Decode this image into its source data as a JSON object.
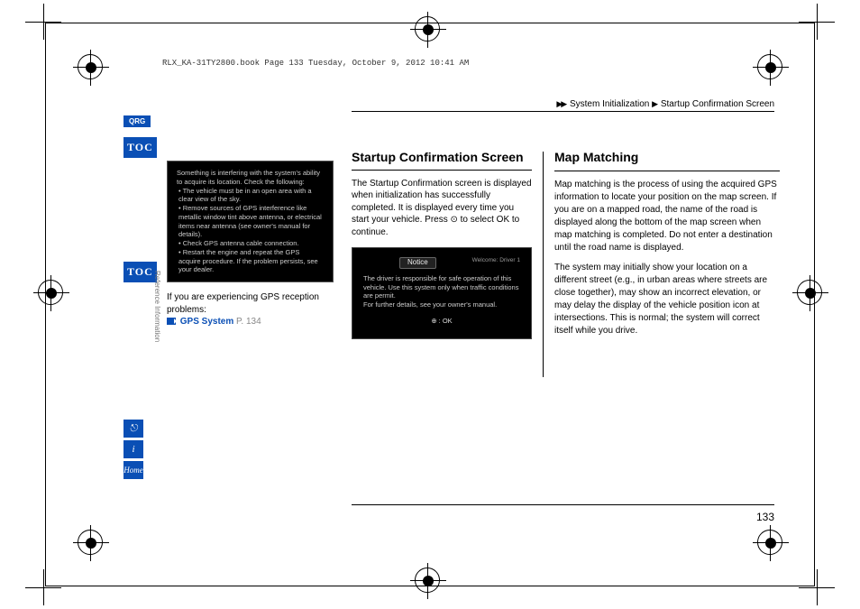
{
  "header_line": "RLX_KA-31TY2800.book  Page 133  Tuesday, October 9, 2012  10:41 AM",
  "breadcrumb": {
    "arrows": "▶▶",
    "part1": "System Initialization",
    "sep": "▶",
    "part2": "Startup Confirmation Screen"
  },
  "badges": {
    "qrg": "QRG",
    "toc": "TOC"
  },
  "side_icons": {
    "voice": "⎋",
    "info": "i",
    "home": "Home"
  },
  "vertical_label": "Reference Information",
  "left": {
    "screen_intro": "Something is interfering with the system's ability to acquire its location. Check the following:",
    "bullets": [
      "The vehicle must be in an open area with a clear view of the sky.",
      "Remove sources of GPS interference like metallic window tint above antenna, or electrical items near antenna (see owner's manual for details).",
      "Check GPS antenna cable connection.",
      "Restart the engine and repeat the GPS acquire procedure. If the problem persists, see your dealer."
    ],
    "gps_note": "If you are experiencing GPS reception problems:",
    "gps_link": "GPS System",
    "gps_page": "P. 134"
  },
  "mid": {
    "heading": "Startup Confirmation Screen",
    "body": "The Startup Confirmation screen is displayed when initialization has successfully completed. It is displayed every time you start your vehicle. Press ⊙ to select OK to continue.",
    "notice_title": "Notice",
    "notice_right": "Welcome: Driver 1",
    "notice_body": "The driver is responsible for safe operation of this vehicle. Use this system only when traffic conditions are permit.\nFor further details, see your owner's manual.",
    "notice_ok": "⊕ : OK"
  },
  "right": {
    "heading": "Map Matching",
    "p1": "Map matching is the process of using the acquired GPS information to locate your position on the map screen. If you are on a mapped road, the name of the road is displayed along the bottom of the map screen when map matching is completed. Do not enter a destination until the road name is displayed.",
    "p2": "The system may initially show your location on a different street (e.g., in urban areas where streets are close together), may show an incorrect elevation, or may delay the display of the vehicle position icon at intersections. This is normal; the system will correct itself while you drive."
  },
  "page_number": "133"
}
